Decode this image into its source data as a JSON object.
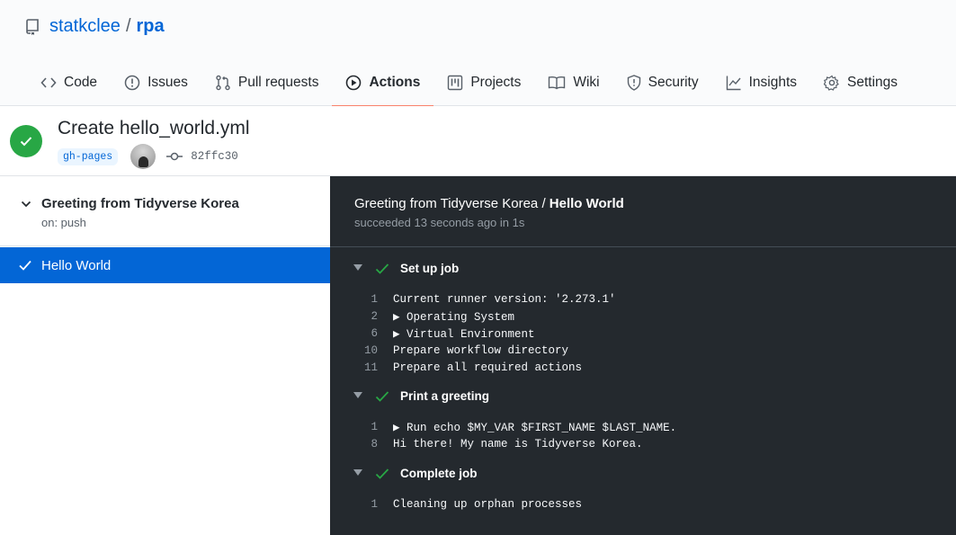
{
  "repo": {
    "owner": "statkclee",
    "separator": "/",
    "name": "rpa"
  },
  "tabs": [
    {
      "label": "Code",
      "icon": "code-icon"
    },
    {
      "label": "Issues",
      "icon": "issue-icon"
    },
    {
      "label": "Pull requests",
      "icon": "pull-request-icon"
    },
    {
      "label": "Actions",
      "icon": "play-icon",
      "selected": true
    },
    {
      "label": "Projects",
      "icon": "project-icon"
    },
    {
      "label": "Wiki",
      "icon": "book-icon"
    },
    {
      "label": "Security",
      "icon": "shield-icon"
    },
    {
      "label": "Insights",
      "icon": "graph-icon"
    },
    {
      "label": "Settings",
      "icon": "gear-icon"
    }
  ],
  "run": {
    "title": "Create hello_world.yml",
    "branch": "gh-pages",
    "commit": "82ffc30",
    "status": "success"
  },
  "workflow": {
    "name": "Greeting from Tidyverse Korea",
    "trigger": "on: push"
  },
  "job": {
    "name": "Hello World"
  },
  "log": {
    "workflow": "Greeting from Tidyverse Korea",
    "separator": "/",
    "job": "Hello World",
    "status_text": "succeeded 13 seconds ago in 1s",
    "steps": [
      {
        "name": "Set up job",
        "lines": [
          {
            "n": "1",
            "text": "Current runner version: '2.273.1'"
          },
          {
            "n": "2",
            "text": "▶ Operating System"
          },
          {
            "n": "6",
            "text": "▶ Virtual Environment"
          },
          {
            "n": "10",
            "text": "Prepare workflow directory"
          },
          {
            "n": "11",
            "text": "Prepare all required actions"
          }
        ]
      },
      {
        "name": "Print a greeting",
        "lines": [
          {
            "n": "1",
            "text": "▶ Run echo $MY_VAR $FIRST_NAME $LAST_NAME."
          },
          {
            "n": "8",
            "text": "Hi there! My name is Tidyverse Korea."
          }
        ]
      },
      {
        "name": "Complete job",
        "lines": [
          {
            "n": "1",
            "text": "Cleaning up orphan processes"
          }
        ]
      }
    ]
  },
  "colors": {
    "accent": "#0366d6",
    "success": "#28a745",
    "tab_underline": "#f9826c",
    "log_bg": "#24292e"
  }
}
